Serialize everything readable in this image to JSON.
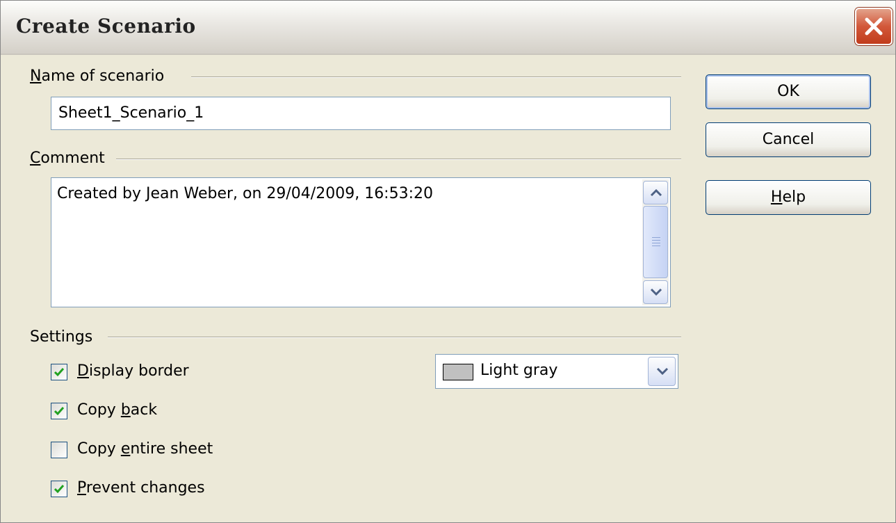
{
  "window": {
    "title": "Create Scenario"
  },
  "name_section": {
    "label_first": "N",
    "label_rest": "ame of scenario",
    "value": "Sheet1_Scenario_1"
  },
  "comment_section": {
    "label_first": "C",
    "label_rest": "omment",
    "value": "Created by Jean Weber, on 29/04/2009, 16:53:20"
  },
  "settings": {
    "label": "Settings",
    "options": [
      {
        "pre": "",
        "key": "D",
        "post": "isplay border",
        "checked": true
      },
      {
        "pre": "Copy ",
        "key": "b",
        "post": "ack",
        "checked": true
      },
      {
        "pre": "Copy ",
        "key": "e",
        "post": "ntire sheet",
        "checked": false
      },
      {
        "pre": "",
        "key": "P",
        "post": "revent changes",
        "checked": true
      }
    ],
    "border_color": {
      "label": "Light gray",
      "swatch": "#c0c0c0"
    }
  },
  "buttons": {
    "ok": "OK",
    "cancel": "Cancel",
    "help_key": "H",
    "help_rest": "elp"
  },
  "colors": {
    "dialog_bg": "#ece9d8",
    "accent_border": "#003c74",
    "check": "#21a121"
  }
}
